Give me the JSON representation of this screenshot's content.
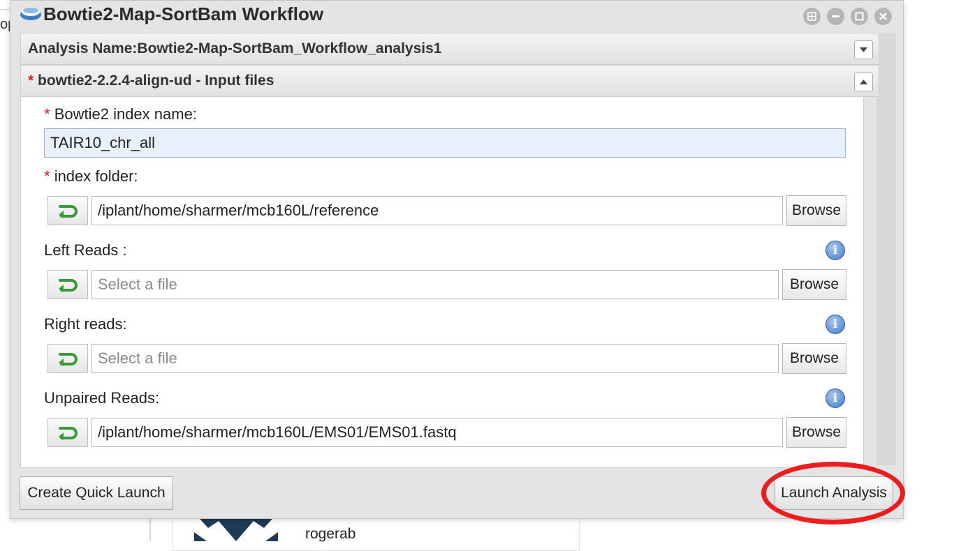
{
  "background": {
    "left_text": "opment",
    "user_name": "rogerab"
  },
  "window": {
    "title": "Bowtie2-Map-SortBam Workflow",
    "controls": [
      "restore",
      "minimize",
      "maximize",
      "close"
    ]
  },
  "analysis_section": {
    "label": "Analysis Name:",
    "value": "Bowtie2-Map-SortBam_Workflow_analysis1",
    "collapsed": true
  },
  "input_section": {
    "required_mark": "*",
    "title": "bowtie2-2.2.4-align-ud - Input files",
    "fields": {
      "index_name": {
        "required_mark": "*",
        "label": "Bowtie2 index name:",
        "value": "TAIR10_chr_all"
      },
      "index_folder": {
        "required_mark": "*",
        "label": "index folder:",
        "value": "/iplant/home/sharmer/mcb160L/reference",
        "browse_label": "Browse"
      },
      "left_reads": {
        "label": "Left Reads :",
        "placeholder": "Select a file",
        "browse_label": "Browse"
      },
      "right_reads": {
        "label": "Right reads:",
        "placeholder": "Select a file",
        "browse_label": "Browse"
      },
      "unpaired_reads": {
        "label": "Unpaired Reads:",
        "value": "/iplant/home/sharmer/mcb160L/EMS01/EMS01.fastq",
        "browse_label": "Browse"
      }
    }
  },
  "footer": {
    "quick_launch_label": "Create Quick Launch",
    "launch_label": "Launch Analysis"
  },
  "colors": {
    "required": "#e11b1b",
    "highlight_field": "#e7f0fb",
    "annotation": "#ee1d1d",
    "info_icon": "#3f78c9"
  }
}
